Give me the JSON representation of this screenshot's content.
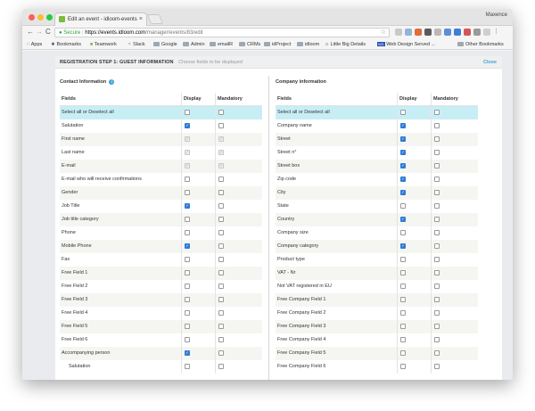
{
  "browser": {
    "tab_title": "Edit an event - idloom-events",
    "tab_close": "×",
    "profile": "Maxence",
    "nav": {
      "back": "←",
      "forward": "→",
      "reload": "C"
    },
    "url": {
      "secure_label": "Secure",
      "host": "https://events.idloom.com",
      "path": "/manager/events/83/edit"
    },
    "bookmarks": {
      "apps": "Apps",
      "items": [
        "Bookmarks",
        "Teamwork",
        "Slack",
        "Google",
        "Admin",
        "emailR",
        "CRMs",
        "idProject",
        "idloom",
        "Little Big Details",
        "Web Design Served ..."
      ],
      "other": "Other Bookmarks"
    }
  },
  "panel": {
    "step_title": "REGISTRATION STEP 1: GUEST INFORMATION",
    "hint": "Choose fields to be displayed",
    "close_label": "Close"
  },
  "contact": {
    "title": "Contact Information",
    "info_icon": "i",
    "headers": {
      "fields": "Fields",
      "display": "Display",
      "mandatory": "Mandatory"
    },
    "rows": [
      {
        "label": "Select all or Deselect all",
        "display": "off",
        "mandatory": "off",
        "highlight": true
      },
      {
        "label": "Salutation",
        "display": "on",
        "mandatory": "off"
      },
      {
        "label": "First name",
        "display": "dis",
        "mandatory": "dis"
      },
      {
        "label": "Last name",
        "display": "dis",
        "mandatory": "dis"
      },
      {
        "label": "E-mail",
        "display": "dis",
        "mandatory": "dis"
      },
      {
        "label": "E-mail who will receive confirmations",
        "display": "off",
        "mandatory": "off"
      },
      {
        "label": "Gender",
        "display": "off",
        "mandatory": "off"
      },
      {
        "label": "Job Title",
        "display": "on",
        "mandatory": "off"
      },
      {
        "label": "Job title category",
        "display": "off",
        "mandatory": "off"
      },
      {
        "label": "Phone",
        "display": "off",
        "mandatory": "off"
      },
      {
        "label": "Mobile Phone",
        "display": "on",
        "mandatory": "off"
      },
      {
        "label": "Fax",
        "display": "off",
        "mandatory": "off"
      },
      {
        "label": "Free Field 1",
        "display": "off",
        "mandatory": "off"
      },
      {
        "label": "Free Field 2",
        "display": "off",
        "mandatory": "off"
      },
      {
        "label": "Free Field 3",
        "display": "off",
        "mandatory": "off"
      },
      {
        "label": "Free Field 4",
        "display": "off",
        "mandatory": "off"
      },
      {
        "label": "Free Field 5",
        "display": "off",
        "mandatory": "off"
      },
      {
        "label": "Free Field 6",
        "display": "off",
        "mandatory": "off"
      },
      {
        "label": "Accompanying person",
        "display": "on",
        "mandatory": "off"
      },
      {
        "label": "Salutation",
        "display": "off",
        "mandatory": "off",
        "indent": true
      }
    ]
  },
  "company": {
    "title": "Company information",
    "headers": {
      "fields": "Fields",
      "display": "Display",
      "mandatory": "Mandatory"
    },
    "rows": [
      {
        "label": "Select all or Deselect all",
        "display": "off",
        "mandatory": "off",
        "highlight": true
      },
      {
        "label": "Company name",
        "display": "on",
        "mandatory": "off"
      },
      {
        "label": "Street",
        "display": "on",
        "mandatory": "off"
      },
      {
        "label": "Street n°",
        "display": "on",
        "mandatory": "off"
      },
      {
        "label": "Street box",
        "display": "on",
        "mandatory": "off"
      },
      {
        "label": "Zip code",
        "display": "on",
        "mandatory": "off"
      },
      {
        "label": "City",
        "display": "on",
        "mandatory": "off"
      },
      {
        "label": "State",
        "display": "off",
        "mandatory": "off"
      },
      {
        "label": "Country",
        "display": "on",
        "mandatory": "off"
      },
      {
        "label": "Company size",
        "display": "off",
        "mandatory": "off"
      },
      {
        "label": "Company category",
        "display": "on",
        "mandatory": "off"
      },
      {
        "label": "Product type",
        "display": "off",
        "mandatory": "off"
      },
      {
        "label": "VAT - Nr",
        "display": "off",
        "mandatory": "off"
      },
      {
        "label": "Not VAT registered in EU",
        "display": "off",
        "mandatory": "off"
      },
      {
        "label": "Free Company Field 1",
        "display": "off",
        "mandatory": "off"
      },
      {
        "label": "Free Company Field 2",
        "display": "off",
        "mandatory": "off"
      },
      {
        "label": "Free Company Field 3",
        "display": "off",
        "mandatory": "off"
      },
      {
        "label": "Free Company Field 4",
        "display": "off",
        "mandatory": "off"
      },
      {
        "label": "Free Company Field 5",
        "display": "off",
        "mandatory": "off"
      },
      {
        "label": "Free Company Field 6",
        "display": "off",
        "mandatory": "off"
      }
    ]
  },
  "colors": {
    "accent": "#3ea3d6",
    "checkbox_on": "#2e7bd6",
    "row_highlight": "#c8eef5",
    "row_alt": "#f5f6f2"
  }
}
